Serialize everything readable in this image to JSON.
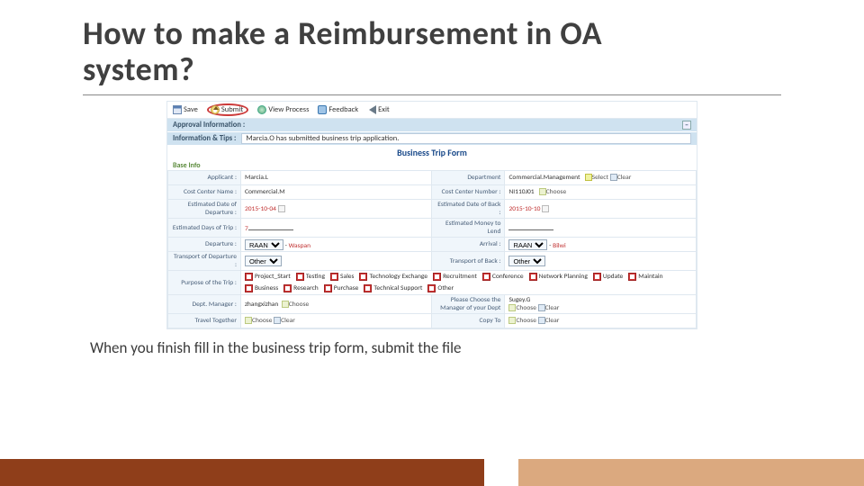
{
  "title_line1": "How to make a Reimbursement in OA",
  "title_line2": "system?",
  "caption": "When you finish fill in the business trip form, submit the file",
  "toolbar": {
    "save": "Save",
    "submit": "Submit",
    "view_process": "View Process",
    "feedback": "Feedback",
    "exit": "Exit"
  },
  "approval_section": "Approval Information :",
  "info_tips_label": "Information & Tips :",
  "info_tips_value": "Marcia.O has submitted business trip application.",
  "form_title": "Business Trip Form",
  "base_info": "Base Info",
  "labels": {
    "applicant": "Applicant :",
    "department": "Department",
    "cost_center_name": "Cost Center Name :",
    "cost_center_number": "Cost Center Number :",
    "est_dep_date": "Estimated Date of Departure :",
    "est_back_date": "Estimated Date of Back :",
    "est_days": "Estimated Days of Trip :",
    "est_money": "Estimated Money to Lend",
    "departure": "Departure :",
    "arrival": "Arrival :",
    "trans_dep": "Transport of Departure :",
    "trans_back": "Transport of Back :",
    "purpose": "Purpose of the Trip :",
    "dept_mgr": "Dept. Manager :",
    "choose_mgr": "Please Choose the Manager of your Dept",
    "travel_tog": "Travel Together",
    "copy_to": "Copy To"
  },
  "values": {
    "applicant": "Marcia.L",
    "department": "Commercial.Management",
    "cost_center_name": "Commercial.M",
    "cost_center_number": "NI110J01",
    "est_dep_date": "2015-10-04",
    "est_back_date": "2015-10-10",
    "est_days": "7",
    "departure_region": "RAAN",
    "departure_city": "Waspan",
    "arrival_region": "RAAN",
    "arrival_city": "Bilwi",
    "trans_dep": "Other",
    "trans_back": "Other",
    "dept_mgr": "zhangxizhan",
    "choose_mgr_val": "Sugey.G"
  },
  "actions": {
    "select": "Select",
    "clear": "Clear",
    "choose": "Choose"
  },
  "purposes": [
    "Project_Start",
    "Testing",
    "Sales",
    "Technology Exchange",
    "Recruitment",
    "Conference",
    "Network Planning",
    "Update",
    "Maintain",
    "Business",
    "Research",
    "Purchase",
    "Technical Support",
    "Other"
  ]
}
